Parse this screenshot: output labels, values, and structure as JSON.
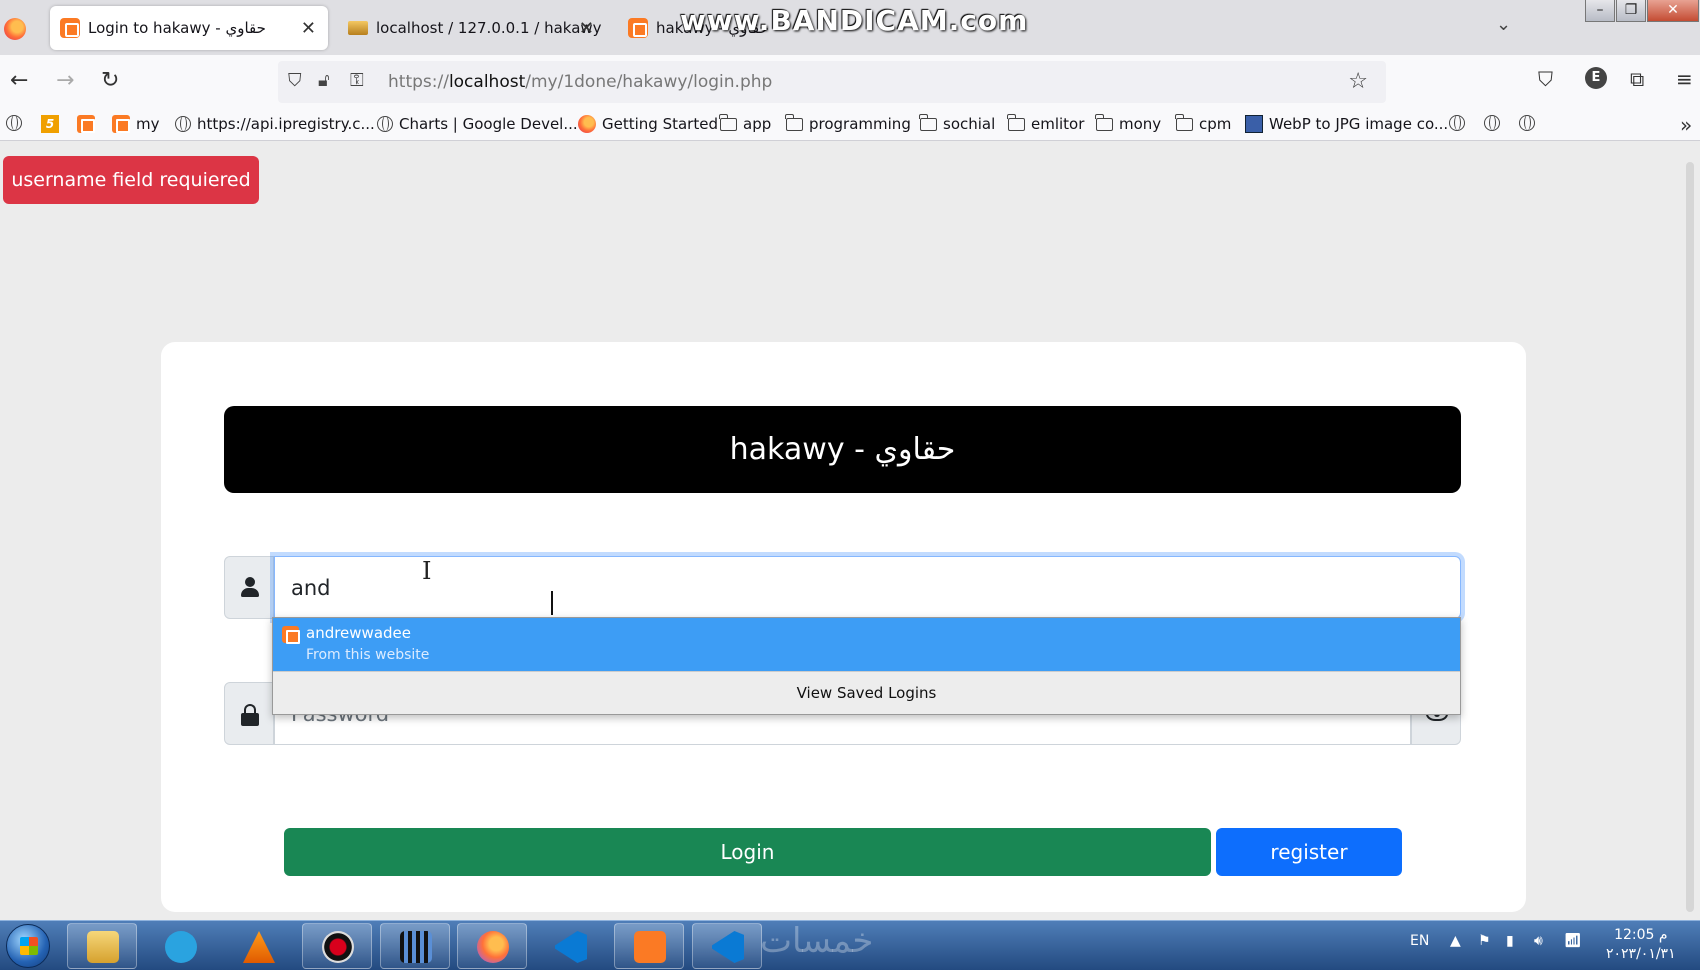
{
  "browser": {
    "tabs": [
      {
        "title": "Login to hakawy - حقاوي",
        "active": true,
        "close": "✕"
      },
      {
        "title": "localhost / 127.0.0.1 / hakawy /",
        "active": false,
        "close": "✕"
      },
      {
        "title": "hakawy - حقاوي",
        "active": false
      }
    ],
    "watermark": "www.BANDICAM.com",
    "url_prefix": "https://",
    "url_host": "localhost",
    "url_path": "/my/1done/hakawy/login.php",
    "account_initial": "E",
    "bookmarks": [
      {
        "label": "",
        "icon": "html5-icon",
        "text": "5"
      },
      {
        "label": "",
        "icon": "xampp-icon"
      },
      {
        "label": "my",
        "icon": "xampp-icon"
      },
      {
        "label": "https://api.ipregistry.c...",
        "icon": "globe-icon"
      },
      {
        "label": "Charts  |  Google Devel...",
        "icon": "globe-icon"
      },
      {
        "label": "Getting Started",
        "icon": "firefox-icon"
      },
      {
        "label": "app",
        "icon": "folder-icon"
      },
      {
        "label": "programming",
        "icon": "folder-icon"
      },
      {
        "label": "sochial",
        "icon": "folder-icon"
      },
      {
        "label": "emlitor",
        "icon": "folder-icon"
      },
      {
        "label": "mony",
        "icon": "folder-icon"
      },
      {
        "label": "cpm",
        "icon": "folder-icon"
      },
      {
        "label": "WebP to JPG image co...",
        "icon": "webp-icon"
      }
    ]
  },
  "page": {
    "alert": "username field requiered",
    "brand": "hakawy - حقاوي",
    "username_value": "and",
    "password_placeholder": "Password",
    "autocomplete": {
      "username": "andrewwadee",
      "source": "From this website",
      "footer": "View Saved Logins"
    },
    "login_label": "Login",
    "register_label": "register"
  },
  "taskbar": {
    "apps": [
      "explorer-icon",
      "telegram-icon",
      "vlc-icon",
      "screen-recorder-icon",
      "movie-maker-icon",
      "firefox-icon",
      "vscode-icon",
      "xampp-icon",
      "vscode-icon"
    ],
    "watermark": "خمسات",
    "lang": "EN",
    "time": "12:05 م",
    "date": "٢٠٢٣/٠١/٣١"
  },
  "colors": {
    "alert": "#dc3545",
    "login": "#198754",
    "register": "#0d6efd",
    "autocomplete_highlight": "#3d9df5",
    "brand_bg": "#000000"
  }
}
